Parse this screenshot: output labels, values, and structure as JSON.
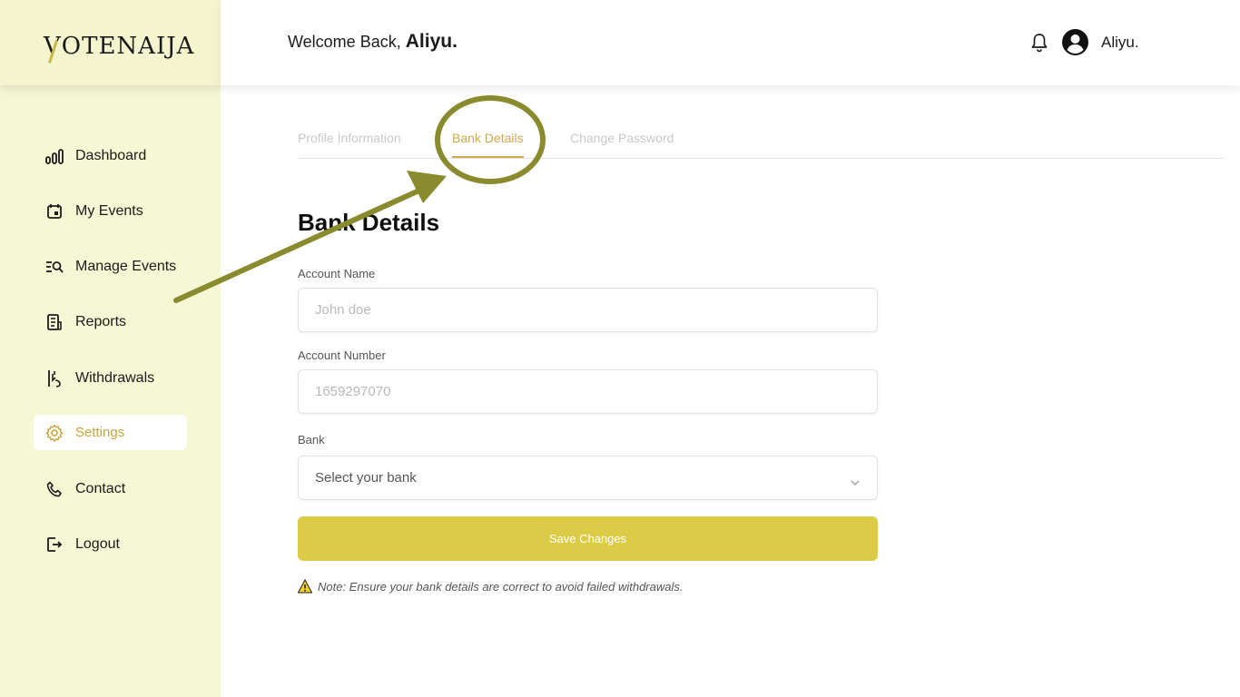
{
  "brand": {
    "logo_text": "OTENAIJA",
    "logo_initial": "V"
  },
  "header": {
    "welcome_prefix": "Welcome Back,",
    "welcome_name": "Aliyu.",
    "user_name": "Aliyu."
  },
  "sidebar": {
    "items": [
      {
        "label": "Dashboard",
        "icon": "bar-chart-icon"
      },
      {
        "label": "My Events",
        "icon": "calendar-icon"
      },
      {
        "label": "Manage Events",
        "icon": "search-list-icon"
      },
      {
        "label": "Reports",
        "icon": "document-icon"
      },
      {
        "label": "Withdrawals",
        "icon": "withdraw-icon"
      },
      {
        "label": "Settings",
        "icon": "gear-icon",
        "active": true
      },
      {
        "label": "Contact",
        "icon": "phone-icon"
      },
      {
        "label": "Logout",
        "icon": "logout-icon"
      }
    ]
  },
  "tabs": [
    {
      "label": "Profile Information",
      "active": false
    },
    {
      "label": "Bank Details",
      "active": true
    },
    {
      "label": "Change Password",
      "active": false
    }
  ],
  "form": {
    "title": "Bank Details",
    "account_name": {
      "label": "Account Name",
      "placeholder": "John doe"
    },
    "account_number": {
      "label": "Account Number",
      "placeholder": "1659297070"
    },
    "bank": {
      "label": "Bank",
      "selected": "Select your bank"
    },
    "save_label": "Save Changes",
    "note": "Note: Ensure your bank details are correct to avoid failed withdrawals."
  },
  "colors": {
    "accent": "#d1a84a",
    "button": "#dccb47",
    "sidebar_bg": "#f6f7d4",
    "annotation": "#8a8a2e"
  }
}
